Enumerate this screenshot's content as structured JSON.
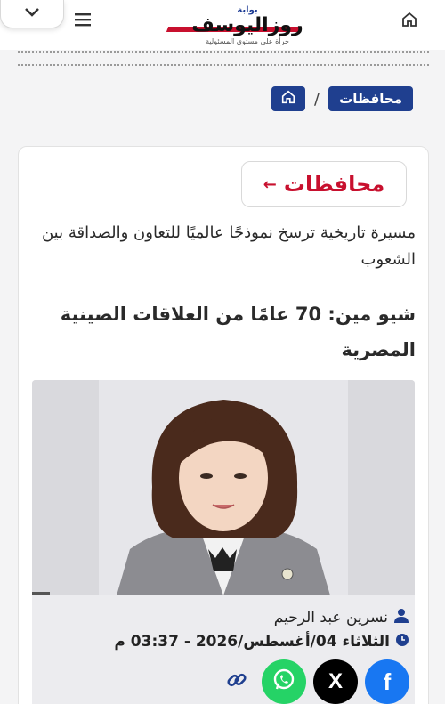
{
  "header": {
    "logo_small": "بوابة",
    "logo_main": "روزاليوسف",
    "logo_tagline": "جرأة على مستوى المسئولية"
  },
  "breadcrumb": {
    "section_label": "محافظات",
    "separator": "/"
  },
  "article": {
    "category_label": "محافظات",
    "category_arrow": "←",
    "subtitle": "مسيرة تاريخية ترسخ نموذجًا عالميًا للتعاون والصداقة بين الشعوب",
    "title": "شيو مين: 70 عامًا من العلاقات الصينية المصرية",
    "author": "نسرين عبد الرحيم",
    "datetime": "الثلاثاء 04/أغسطس/2026 - 03:37 م"
  },
  "share": {
    "facebook_label": "f",
    "x_label": "X"
  },
  "colors": {
    "brand_blue": "#1f3f8f",
    "brand_red": "#c8102e",
    "facebook": "#1877f2",
    "whatsapp": "#25d366",
    "x": "#000000"
  },
  "icons": [
    "chevron-down-icon",
    "menu-icon",
    "home-icon",
    "user-icon",
    "clock-icon",
    "facebook-icon",
    "x-icon",
    "whatsapp-icon",
    "link-icon"
  ]
}
